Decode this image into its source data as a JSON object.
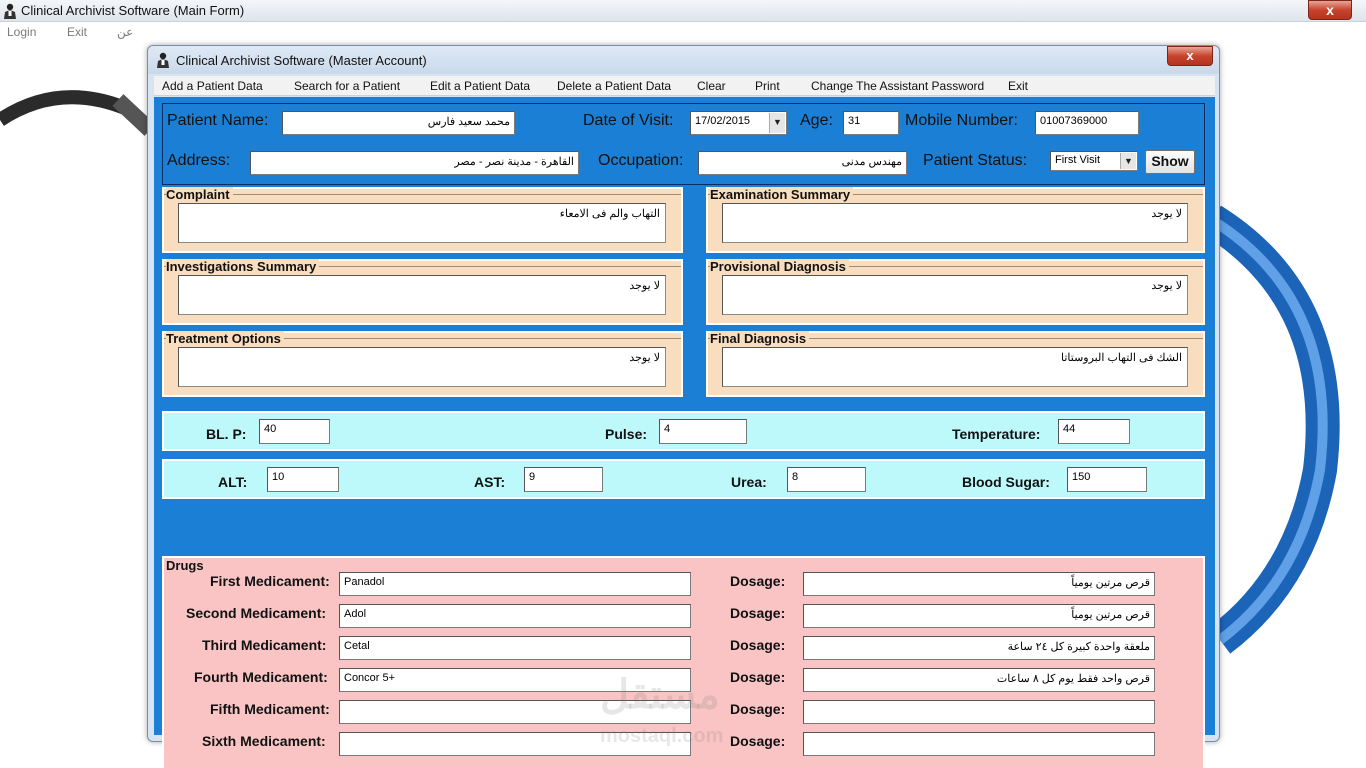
{
  "main_window": {
    "title": "Clinical Archivist Software (Main Form)",
    "close_symbol": "x",
    "menu": [
      "Login",
      "Exit",
      "عن"
    ]
  },
  "child_window": {
    "title": "Clinical Archivist Software (Master Account)",
    "close_symbol": "x",
    "menu": [
      "Add a Patient Data",
      "Search for a Patient",
      "Edit a Patient Data",
      "Delete a Patient Data",
      "Clear",
      "Print",
      "Change The Assistant Password",
      "Exit"
    ]
  },
  "patient": {
    "name_label": "Patient Name:",
    "name": "محمد سعيد فارس",
    "date_label": "Date of Visit:",
    "date": "17/02/2015",
    "age_label": "Age:",
    "age": "31",
    "mobile_label": "Mobile Number:",
    "mobile": "01007369000",
    "address_label": "Address:",
    "address": "القاهرة - مدينة نصر - مصر",
    "occupation_label": "Occupation:",
    "occupation": "مهندس مدنى",
    "status_label": "Patient Status:",
    "status": "First Visit",
    "show_button": "Show"
  },
  "groups": {
    "complaint": {
      "title": "Complaint",
      "text": "التهاب والم فى الامعاء"
    },
    "examination": {
      "title": "Examination Summary",
      "text": "لا يوجد"
    },
    "investigations": {
      "title": "Investigations Summary",
      "text": "لا يوجد"
    },
    "provisional": {
      "title": "Provisional Diagnosis",
      "text": "لا يوجد"
    },
    "treatment": {
      "title": "Treatment Options",
      "text": "لا يوجد"
    },
    "final": {
      "title": "Final Diagnosis",
      "text": "الشك فى التهاب البروستاتا"
    }
  },
  "vitals": {
    "blp_label": "BL. P:",
    "blp": "40",
    "pulse_label": "Pulse:",
    "pulse": "4",
    "temp_label": "Temperature:",
    "temp": "44",
    "alt_label": "ALT:",
    "alt": "10",
    "ast_label": "AST:",
    "ast": "9",
    "urea_label": "Urea:",
    "urea": "8",
    "sugar_label": "Blood Sugar:",
    "sugar": "150"
  },
  "drugs": {
    "title": "Drugs",
    "dosage_label": "Dosage:",
    "rows": [
      {
        "label": "First Medicament:",
        "value": "Panadol",
        "dosage": "قرص مرتين يومياً"
      },
      {
        "label": "Second Medicament:",
        "value": "Adol",
        "dosage": "قرص مرتين يومياً"
      },
      {
        "label": "Third Medicament:",
        "value": "Cetal",
        "dosage": "ملعقة واحدة كبيرة كل ٢٤ ساعة"
      },
      {
        "label": "Fourth Medicament:",
        "value": "Concor 5+",
        "dosage": "قرص واحد فقط يوم كل ٨ ساعات"
      },
      {
        "label": "Fifth Medicament:",
        "value": "",
        "dosage": ""
      },
      {
        "label": "Sixth Medicament:",
        "value": "",
        "dosage": ""
      }
    ]
  },
  "watermark": {
    "text": "مستقل",
    "sub": "mostaql.com"
  },
  "colors": {
    "client_bg": "#1b7fd6",
    "group_bg": "#f8ddbe",
    "vitals_bg": "#bdf8fb",
    "drugs_bg": "#fbc4c4"
  }
}
